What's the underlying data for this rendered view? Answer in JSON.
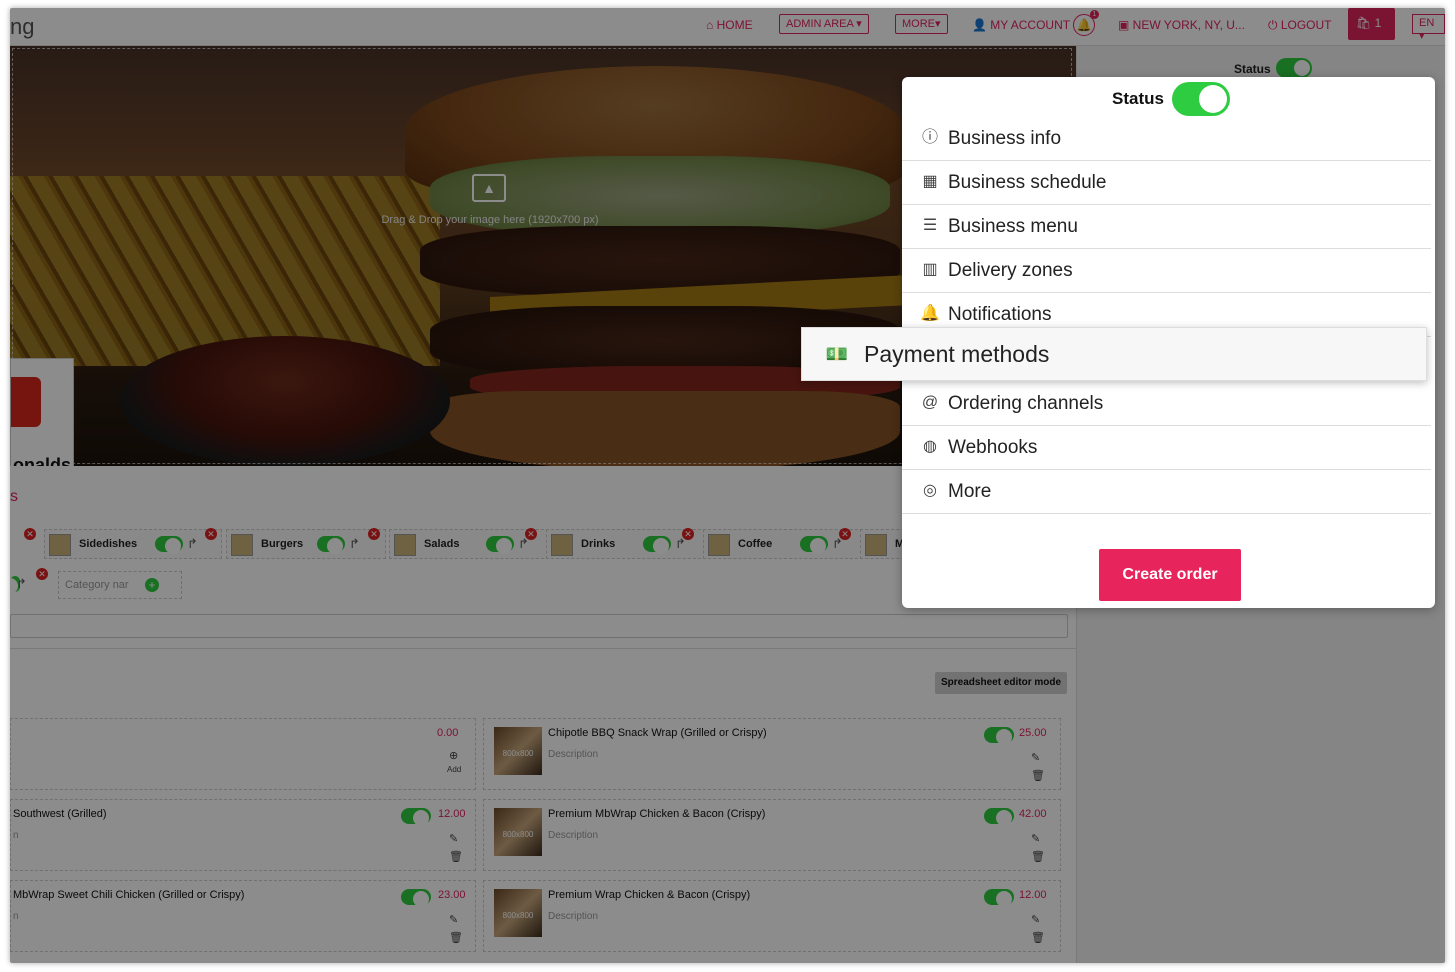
{
  "topbar": {
    "brand": "ng",
    "home": "HOME",
    "admin_area": "ADMIN AREA",
    "more": "MORE",
    "my_account": "MY ACCOUNT",
    "notification_count": "1",
    "location": "NEW YORK, NY, U...",
    "logout": "LOGOUT",
    "cart_count": "1",
    "language": "EN"
  },
  "hero": {
    "upload_text": "Drag & Drop your image here (1920x700 px)",
    "logo_text": "onalds"
  },
  "right_panel": {
    "status_label": "Status"
  },
  "categories": {
    "heading": "s",
    "items": [
      "Sidedishes",
      "Burgers",
      "Salads",
      "Drinks",
      "Coffee",
      "M"
    ],
    "new_category_placeholder": "Category nar"
  },
  "menu_items": {
    "spreadsheet_button": "Spreadsheet editor mode",
    "left": [
      {
        "name": "",
        "price": "0.00",
        "add_label": "Add"
      },
      {
        "name": "Southwest (Grilled)",
        "desc": "n",
        "price": "12.00"
      },
      {
        "name": "MbWrap Sweet Chili Chicken (Grilled or Crispy)",
        "desc": "n",
        "price": "23.00"
      }
    ],
    "right": [
      {
        "name": "Chipotle BBQ Snack Wrap (Grilled or Crispy)",
        "desc": "Description",
        "price": "25.00",
        "thumb": "800x800"
      },
      {
        "name": "Premium MbWrap Chicken & Bacon (Crispy)",
        "desc": "Description",
        "price": "42.00",
        "thumb": "800x800"
      },
      {
        "name": "Premium Wrap Chicken & Bacon (Crispy)",
        "desc": "Description",
        "price": "12.00",
        "thumb": "800x800"
      }
    ]
  },
  "popup": {
    "status_label": "Status",
    "items": [
      {
        "label": "Business info",
        "icon": "info-icon"
      },
      {
        "label": "Business schedule",
        "icon": "calendar-icon"
      },
      {
        "label": "Business menu",
        "icon": "list-icon"
      },
      {
        "label": "Delivery zones",
        "icon": "map-icon"
      },
      {
        "label": "Notifications",
        "icon": "bell-icon"
      },
      {
        "label": "Payment methods",
        "icon": "money-icon"
      },
      {
        "label": "Ordering channels",
        "icon": "at-icon"
      },
      {
        "label": "Webhooks",
        "icon": "globe-icon"
      },
      {
        "label": "More",
        "icon": "target-icon"
      }
    ],
    "create_order": "Create order"
  },
  "colors": {
    "accent": "#e0245e",
    "toggle_on": "#2ecc40"
  }
}
